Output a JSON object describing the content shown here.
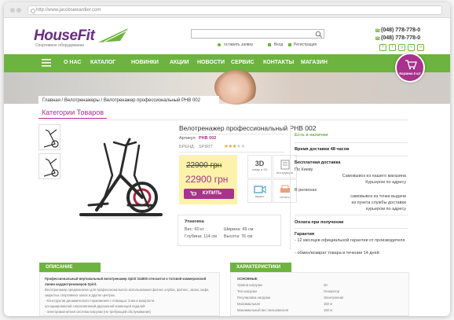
{
  "browser": {
    "url": "http://www.jacobsewardier.com"
  },
  "header": {
    "logo": "HouseFit",
    "logo_sub": "Спортивное оборудование",
    "search_placeholder": "",
    "links": [
      "оставить заявку",
      "Вход",
      "Регистрация"
    ],
    "phones": [
      "(048) 778-778-0",
      "(048) 778-778-0"
    ]
  },
  "nav": {
    "items": [
      "О НАС",
      "КАТАЛОГ",
      "НОВИНКИ",
      "АКЦИИ",
      "НОВОСТИ",
      "СЕРВИС",
      "КОНТАКТЫ",
      "МАГАЗИН"
    ],
    "cart_label": "Корзина 0 шт"
  },
  "breadcrumb": "Главная / Велотренажеры / Велотренажер профессиональный PHB 002",
  "categories_title": "Категории Товаров",
  "product": {
    "title": "Велотренажер профессиональный PHB 002",
    "article_label": "Артикул:",
    "article": "PHB 002",
    "brand_label": "БРЕНД:",
    "brand": "SPIRIT",
    "rating": 3,
    "rating_max": 5,
    "old_price": "22900 грн",
    "new_price": "22900 грн",
    "buy_label": "КУПИТЬ",
    "icons": [
      "товар в 3D",
      "инструкция",
      "видео",
      "печать"
    ],
    "icon_3d_text": "3D",
    "spec_title": "Упаковка",
    "specs": [
      "Вес:  60 кг",
      "Ширина:  49 см",
      "Глубина:  114 см",
      "Высота:  76 см"
    ]
  },
  "side": {
    "in_stock": "Есть в наличии",
    "delivery_time": "Время доставки 48 часов",
    "free_delivery": "Бесплатная доставка",
    "kyiv": "По Киеву",
    "kyiv_lines": [
      "Самовывоз из нашего магазина",
      "Курьером по адресу"
    ],
    "regions": "В регионах",
    "region_lines": [
      "самовывоз из точки выдачи",
      "из пункта службы доставки",
      "курьером по адресу"
    ],
    "payment": "Оплата при получении",
    "warranty": "Гарантия",
    "warranty_lines": [
      "- 12 месяцев официальной гарантии от производителя",
      "- обмен/возврат товара в течении 14 дней"
    ]
  },
  "tabs": {
    "description": "ОПИСАНИЕ",
    "characteristics": "ХАРАКТЕРИСТИКИ"
  },
  "description_lines": [
    "Профессиональный вертикальный велотренажер Spirit GU800 относится к тоговой коммерческой",
    "линии кардиотренажеров Spirit.",
    "Велотренажер предназначен для профессионального использования фитнес клубах, фитнес, залах, кафе,",
    "закрытых спортивных залах и других центрах.",
    "- Конструктив динамического торможения с помощью 3 мм и мощности",
    "ассоциированной сопротивлений двухзонной конвенцей педалей",
    "- Электромагнитная система нагрузки (не требующей обслуживания)"
  ],
  "characteristics": {
    "heading": "ОСНОВНЫЕ",
    "rows": [
      [
        "Уровни нагрузки",
        "40"
      ],
      [
        "Тип нагрузки",
        "Генератор"
      ],
      [
        "Регулировка нагрузки",
        "Электронная"
      ],
      [
        "Максимальная",
        "150 кг"
      ],
      [
        "Максимальный вес пользователя",
        "150 кг"
      ]
    ]
  },
  "colors": {
    "green": "#6db33f",
    "purple": "#a8328c",
    "yellow": "#fcf2a9"
  }
}
